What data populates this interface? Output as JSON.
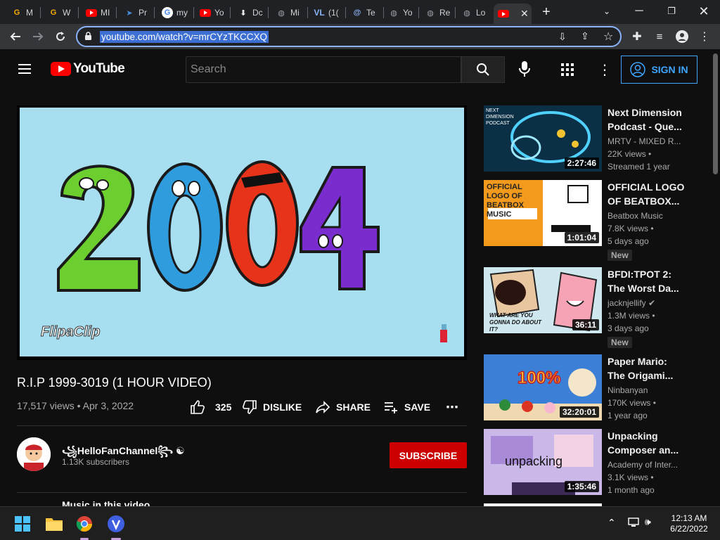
{
  "browser": {
    "tabs": [
      {
        "label": "M",
        "icon": "gmail-icon"
      },
      {
        "label": "W",
        "icon": "google-icon"
      },
      {
        "label": "MI",
        "icon": "youtube-icon"
      },
      {
        "label": "Pr",
        "icon": "app-icon"
      },
      {
        "label": "my",
        "icon": "google-icon"
      },
      {
        "label": "Yo",
        "icon": "youtube-icon"
      },
      {
        "label": "Dc",
        "icon": "download-icon"
      },
      {
        "label": "Mi",
        "icon": "globe-icon"
      },
      {
        "label": "(1(",
        "icon": "vl-icon"
      },
      {
        "label": "Te",
        "icon": "at-icon"
      },
      {
        "label": "Yo",
        "icon": "globe-icon"
      },
      {
        "label": "Re",
        "icon": "globe-icon"
      },
      {
        "label": "Lo",
        "icon": "globe-icon"
      },
      {
        "label": "",
        "icon": "youtube-icon"
      }
    ],
    "url": "youtube.com/watch?v=mrCYzTKCCXQ"
  },
  "yt": {
    "logo_text": "YouTube",
    "search_placeholder": "Search",
    "signin_label": "SIGN IN"
  },
  "video": {
    "title": "R.I.P 1999-3019 (1 HOUR VIDEO)",
    "views": "17,517 views",
    "date": "Apr 3, 2022",
    "likes": "325",
    "dislike_label": "DISLIKE",
    "share_label": "SHARE",
    "save_label": "SAVE",
    "frame_text": "2004",
    "watermark": "FlipaClip"
  },
  "channel": {
    "name": "꧁HelloFanChannel꧂ ☯",
    "subscribers": "1.13K subscribers",
    "subscribe_label": "SUBSCRIBE",
    "music_heading": "Music in this video"
  },
  "recommendations": [
    {
      "title1": "Next Dimension",
      "title2": "Podcast - Que...",
      "channel": "MRTV - MIXED R...",
      "views": "22K views •",
      "age": "Streamed 1 year",
      "duration": "2:27:46",
      "new": "",
      "thumb_text": "NEXT DIMENSION PODCAST"
    },
    {
      "title1": "OFFICIAL LOGO",
      "title2": "OF BEATBOX...",
      "channel": "Beatbox Music",
      "views": "7.8K views •",
      "age": "5 days ago",
      "duration": "1:01:04",
      "new": "New",
      "thumb_text": "OFFICIAL LOGO OF BEATBOX MUSIC"
    },
    {
      "title1": "BFDI:TPOT 2:",
      "title2": "The Worst Da...",
      "channel": "jacknjellify",
      "views": "1.3M views •",
      "age": "3 days ago",
      "duration": "36:11",
      "new": "New",
      "thumb_text": "WHAT ARE YOU GONNA DO ABOUT IT?"
    },
    {
      "title1": "Paper Mario:",
      "title2": "The Origami...",
      "channel": "Ninbanyan",
      "views": "170K views •",
      "age": "1 year ago",
      "duration": "32:20:01",
      "new": "",
      "thumb_text": "100%"
    },
    {
      "title1": "Unpacking",
      "title2": "Composer an...",
      "channel": "Academy of Inter...",
      "views": "3.1K views •",
      "age": "1 month ago",
      "duration": "1:35:46",
      "new": "",
      "thumb_text": "unpacking"
    }
  ],
  "taskbar": {
    "time": "12:13 AM",
    "date": "6/22/2022"
  },
  "colors": {
    "yt_red": "#ff0000",
    "subscribe_red": "#cc0000",
    "link_blue": "#3ea6ff",
    "bg": "#0f0f0f"
  }
}
